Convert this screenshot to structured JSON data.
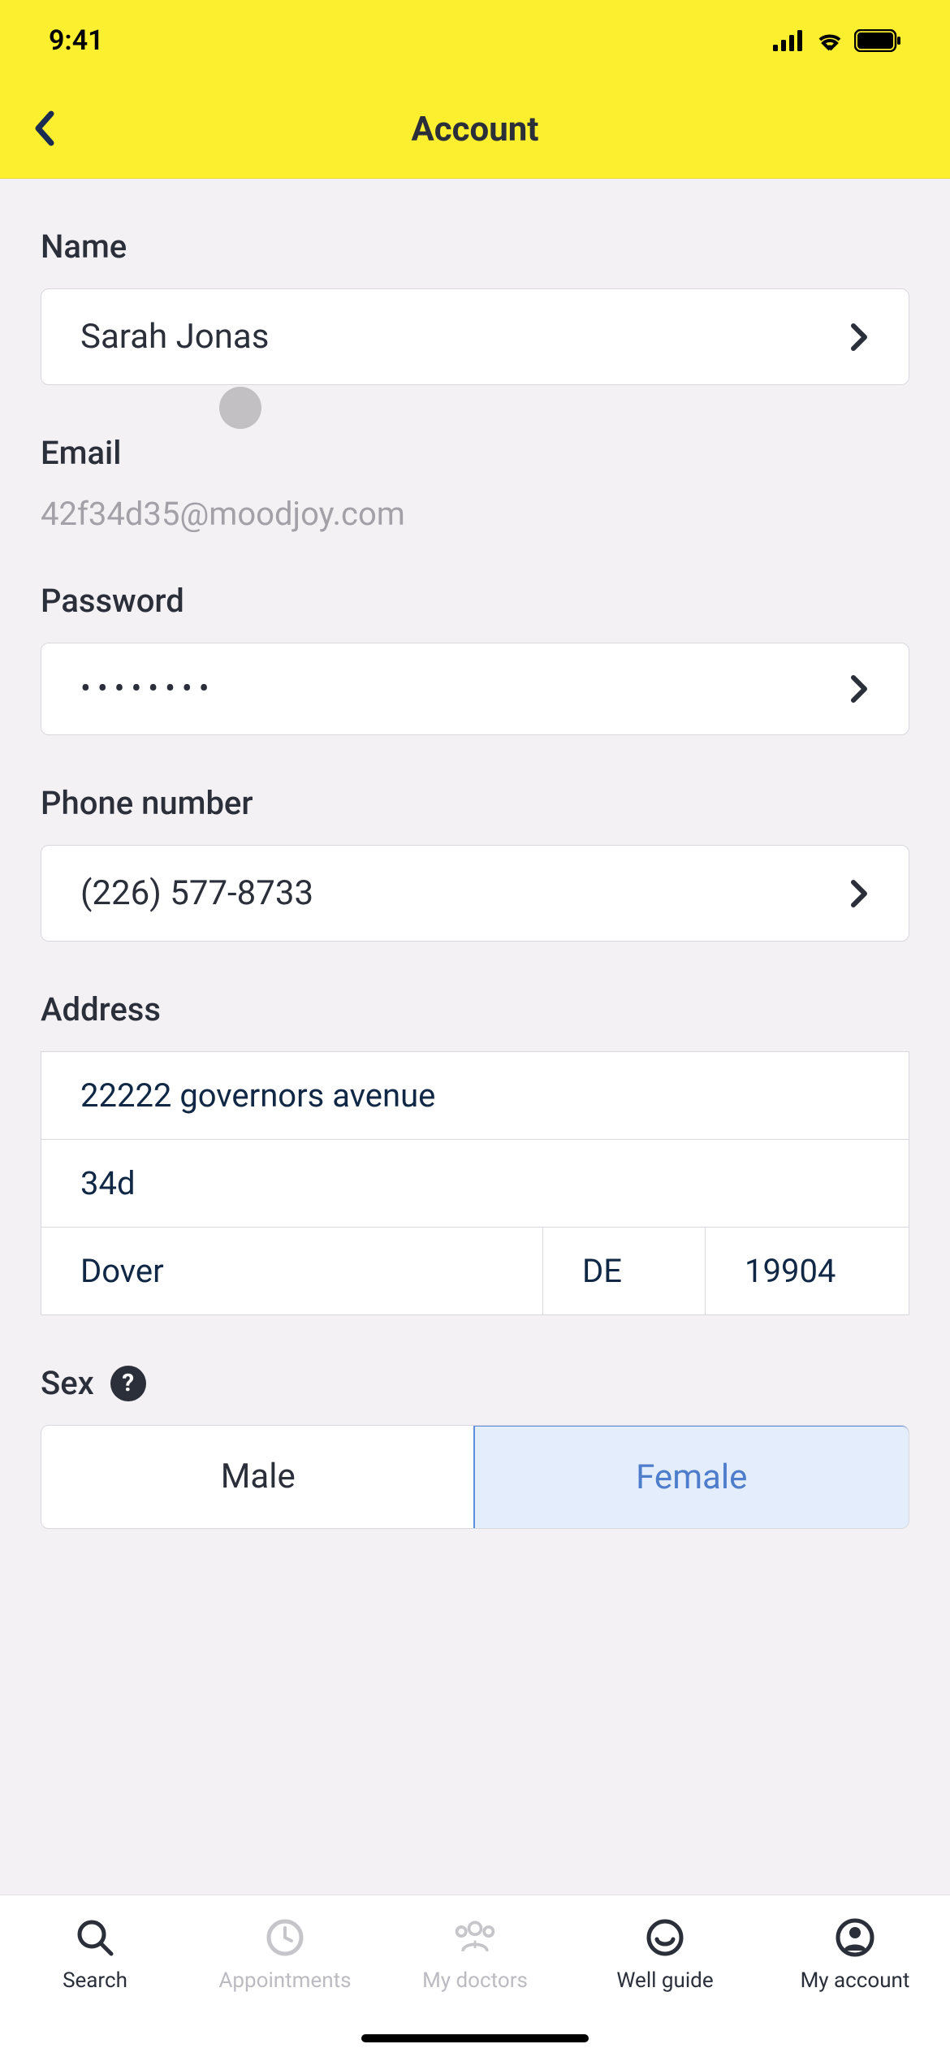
{
  "statusBar": {
    "time": "9:41"
  },
  "header": {
    "title": "Account"
  },
  "fields": {
    "name": {
      "label": "Name",
      "value": "Sarah Jonas"
    },
    "email": {
      "label": "Email",
      "value": "42f34d35@moodjoy.com"
    },
    "password": {
      "label": "Password",
      "value": "••••••••"
    },
    "phone": {
      "label": "Phone number",
      "value": "(226) 577-8733"
    },
    "address": {
      "label": "Address",
      "line1": "22222 governors avenue",
      "line2": "34d",
      "city": "Dover",
      "state": "DE",
      "zip": "19904"
    },
    "sex": {
      "label": "Sex",
      "helpGlyph": "?",
      "options": {
        "male": "Male",
        "female": "Female"
      },
      "selected": "female"
    }
  },
  "bottomNav": {
    "search": "Search",
    "appointments": "Appointments",
    "mydoctors": "My doctors",
    "wellguide": "Well guide",
    "myaccount": "My account"
  }
}
